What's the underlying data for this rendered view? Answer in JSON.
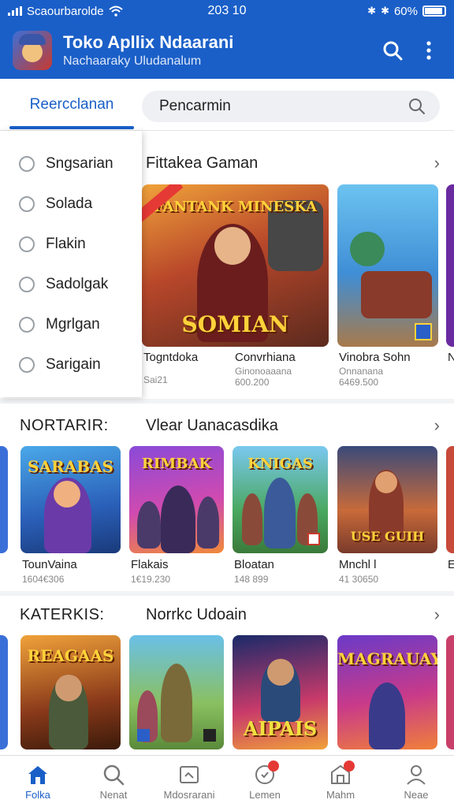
{
  "status": {
    "carrier": "Scaourbarolde",
    "time": "203 10",
    "battery": "60%"
  },
  "app": {
    "title": "Toko Apllix Ndaarani",
    "subtitle": "Nachaaraky Uludanalum",
    "search_icon": "search-icon",
    "menu_icon": "more-vert-icon"
  },
  "tabs": {
    "active_label": "Reercclanan",
    "search_value": "Pencarmin"
  },
  "dropdown": {
    "items": [
      {
        "label": "Sngsarian"
      },
      {
        "label": "Solada"
      },
      {
        "label": "Flakin"
      },
      {
        "label": "Sadolgak"
      },
      {
        "label": "Mgrlgan"
      },
      {
        "label": "Sarigain"
      }
    ]
  },
  "section1": {
    "heading": "Fittakea Gaman",
    "cards": [
      {
        "name": "Togntdoka",
        "sub": "Sai21",
        "art_text": "FANTANK MINESKA",
        "art_text2": "SOMIAN"
      },
      {
        "name": "Convrhiana",
        "sub": "Ginonoaaana 600.200"
      },
      {
        "name": "Vinobra Sohn",
        "sub": "Onnanana 6469.500"
      },
      {
        "name": "N",
        "sub": ""
      }
    ]
  },
  "section2": {
    "heading": "NORTARIR:",
    "heading2": "Vlear Uanacasdika",
    "cards": [
      {
        "name": "TounVaina",
        "sub": "1604€306",
        "art_text": "SARABAS"
      },
      {
        "name": "Flakais",
        "sub": "1€19.230",
        "art_text": "RIMBAK"
      },
      {
        "name": "Bloatan",
        "sub": "148 899",
        "art_text": "KNIGAS"
      },
      {
        "name": "Mnchl l",
        "sub": "41 30650",
        "art_text": "USE GUIH"
      },
      {
        "name": "E",
        "sub": ""
      }
    ]
  },
  "section3": {
    "heading": "KATERKIS:",
    "heading2": "Norrkc Udoain",
    "cards": [
      {
        "name": "",
        "art_text": "REAGAAS"
      },
      {
        "name": "",
        "art_text": ""
      },
      {
        "name": "",
        "art_text": "AIPAIS"
      },
      {
        "name": "",
        "art_text": "MAGRAUAY"
      }
    ]
  },
  "nav": {
    "items": [
      {
        "label": "Folka",
        "icon": "home-icon"
      },
      {
        "label": "Nenat",
        "icon": "search-icon"
      },
      {
        "label": "Mdosrarani",
        "icon": "library-icon"
      },
      {
        "label": "Lemen",
        "icon": "chat-icon"
      },
      {
        "label": "Mahm",
        "icon": "store-icon"
      },
      {
        "label": "Neae",
        "icon": "profile-icon"
      }
    ]
  },
  "colors": {
    "primary": "#1a5fc8",
    "badge": "#e53935"
  }
}
